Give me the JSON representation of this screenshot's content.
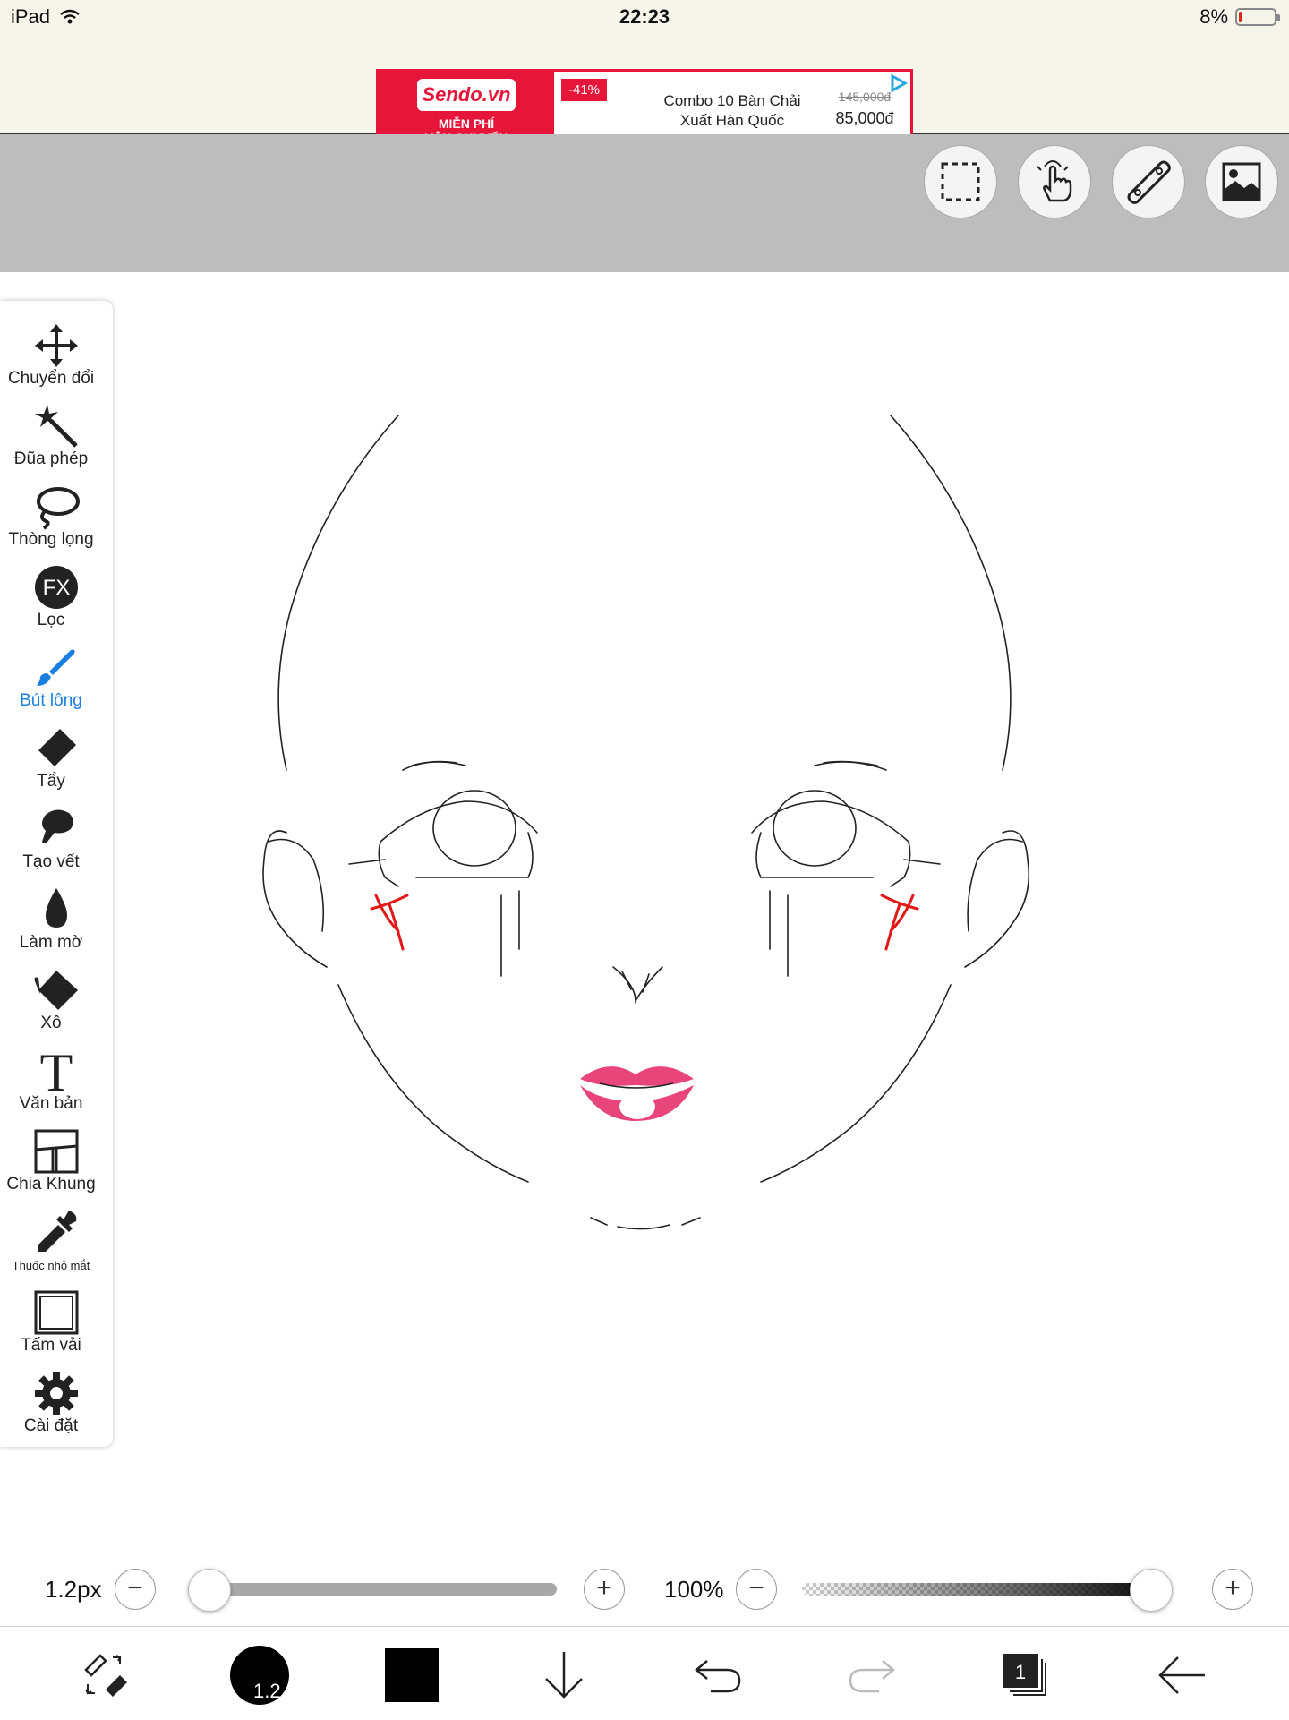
{
  "status": {
    "device": "iPad",
    "time": "22:23",
    "battery": "8%",
    "battery_level": 0.08
  },
  "ad": {
    "brand": "Sendo.vn",
    "shipping_line1": "MIỄN PHÍ",
    "shipping_line2": "VẬN CHUYỂN",
    "discount": "-41%",
    "product_line1": "Combo 10 Bàn Chải",
    "product_line2": "Xuất Hàn Quốc",
    "old_price": "145,000đ",
    "new_price": "85,000đ"
  },
  "top_tools": [
    {
      "name": "selection-icon"
    },
    {
      "name": "hand-gesture-icon"
    },
    {
      "name": "ruler-icon"
    },
    {
      "name": "image-layer-icon"
    }
  ],
  "tools": [
    {
      "label": "Chuyển đổi",
      "icon": "move-icon"
    },
    {
      "label": "Đũa phép",
      "icon": "magic-wand-icon"
    },
    {
      "label": "Thòng lọng",
      "icon": "lasso-icon"
    },
    {
      "label": "Lọc",
      "icon": "fx-filter-icon"
    },
    {
      "label": "Bút lông",
      "icon": "brush-icon",
      "active": true
    },
    {
      "label": "Tẩy",
      "icon": "eraser-icon"
    },
    {
      "label": "Tạo vết",
      "icon": "smudge-icon"
    },
    {
      "label": "Làm mờ",
      "icon": "blur-drop-icon"
    },
    {
      "label": "Xô",
      "icon": "bucket-icon"
    },
    {
      "label": "Văn bản",
      "icon": "text-icon"
    },
    {
      "label": "Chia Khung",
      "icon": "frame-divider-icon"
    },
    {
      "label": "Thuốc nhỏ mắt",
      "icon": "eyedropper-icon"
    },
    {
      "label": "Tấm vải",
      "icon": "canvas-icon"
    },
    {
      "label": "Cài đặt",
      "icon": "settings-gear-icon"
    }
  ],
  "sliders": {
    "size_label": "1.2px",
    "size_fraction": 0.0,
    "opacity_label": "100%",
    "opacity_fraction": 1.0,
    "minus": "−",
    "plus": "+"
  },
  "bottom": {
    "brush_size": "1.2",
    "current_color": "#000000",
    "layer_count": "1"
  },
  "colors": {
    "accent_blue": "#1a7fe0",
    "ad_red": "#e5163a",
    "cheek_red": "#e01818",
    "lip_pink": "#e8457a"
  }
}
